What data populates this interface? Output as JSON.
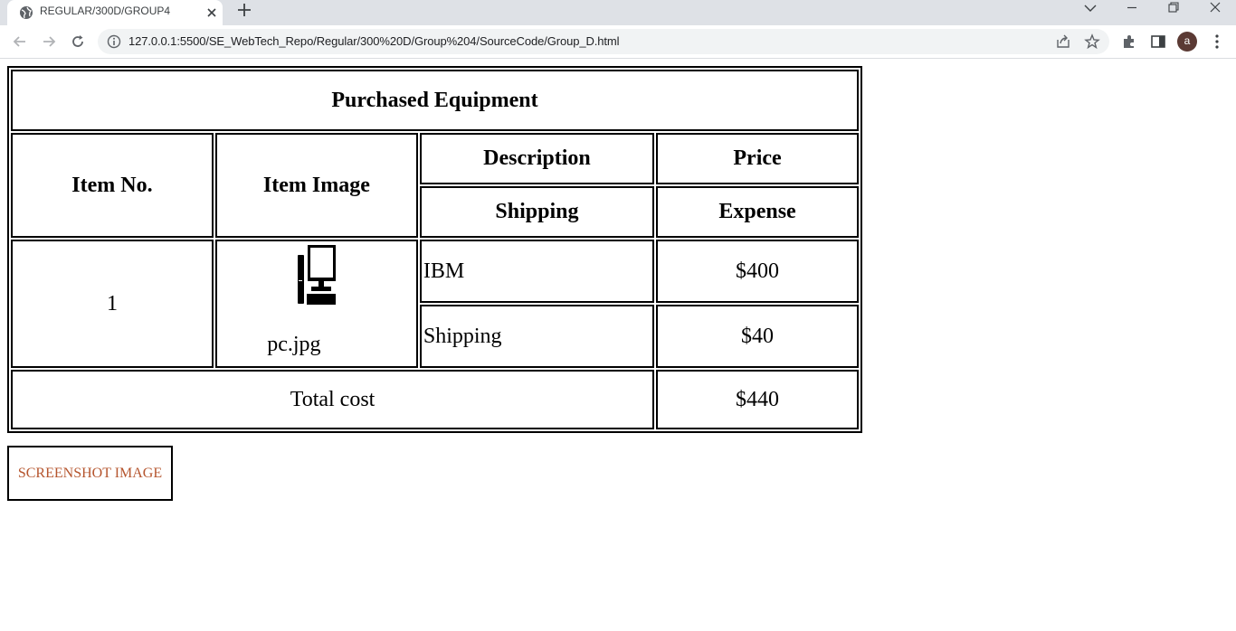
{
  "browser": {
    "tab_title": "REGULAR/300D/GROUP4",
    "url": "127.0.0.1:5500/SE_WebTech_Repo/Regular/300%20D/Group%204/SourceCode/Group_D.html",
    "profile_initial": "a"
  },
  "table": {
    "caption": "Purchased Equipment",
    "headers": {
      "item_no": "Item No.",
      "item_image": "Item Image",
      "description": "Description",
      "price": "Price",
      "shipping": "Shipping",
      "expense": "Expense"
    },
    "row": {
      "item_no": "1",
      "image_name": "pc.jpg",
      "description": "IBM",
      "price": "$400",
      "shipping_label": "Shipping",
      "shipping_cost": "$40"
    },
    "total_label": "Total cost",
    "total_value": "$440"
  },
  "screenshot_button": "SCREENSHOT IMAGE",
  "colors": {
    "button_text": "#b5552e",
    "tabstrip": "#dee1e6",
    "omnibox": "#f1f3f4"
  }
}
